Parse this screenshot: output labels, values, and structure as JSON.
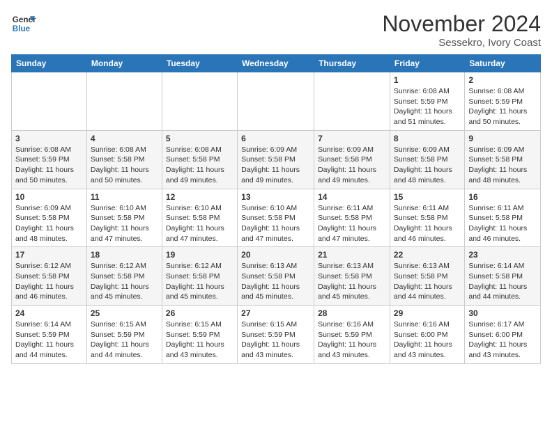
{
  "header": {
    "logo_line1": "General",
    "logo_line2": "Blue",
    "month_title": "November 2024",
    "subtitle": "Sessekro, Ivory Coast"
  },
  "days_of_week": [
    "Sunday",
    "Monday",
    "Tuesday",
    "Wednesday",
    "Thursday",
    "Friday",
    "Saturday"
  ],
  "weeks": [
    [
      {
        "day": "",
        "info": ""
      },
      {
        "day": "",
        "info": ""
      },
      {
        "day": "",
        "info": ""
      },
      {
        "day": "",
        "info": ""
      },
      {
        "day": "",
        "info": ""
      },
      {
        "day": "1",
        "info": "Sunrise: 6:08 AM\nSunset: 5:59 PM\nDaylight: 11 hours and 51 minutes."
      },
      {
        "day": "2",
        "info": "Sunrise: 6:08 AM\nSunset: 5:59 PM\nDaylight: 11 hours and 50 minutes."
      }
    ],
    [
      {
        "day": "3",
        "info": "Sunrise: 6:08 AM\nSunset: 5:59 PM\nDaylight: 11 hours and 50 minutes."
      },
      {
        "day": "4",
        "info": "Sunrise: 6:08 AM\nSunset: 5:58 PM\nDaylight: 11 hours and 50 minutes."
      },
      {
        "day": "5",
        "info": "Sunrise: 6:08 AM\nSunset: 5:58 PM\nDaylight: 11 hours and 49 minutes."
      },
      {
        "day": "6",
        "info": "Sunrise: 6:09 AM\nSunset: 5:58 PM\nDaylight: 11 hours and 49 minutes."
      },
      {
        "day": "7",
        "info": "Sunrise: 6:09 AM\nSunset: 5:58 PM\nDaylight: 11 hours and 49 minutes."
      },
      {
        "day": "8",
        "info": "Sunrise: 6:09 AM\nSunset: 5:58 PM\nDaylight: 11 hours and 48 minutes."
      },
      {
        "day": "9",
        "info": "Sunrise: 6:09 AM\nSunset: 5:58 PM\nDaylight: 11 hours and 48 minutes."
      }
    ],
    [
      {
        "day": "10",
        "info": "Sunrise: 6:09 AM\nSunset: 5:58 PM\nDaylight: 11 hours and 48 minutes."
      },
      {
        "day": "11",
        "info": "Sunrise: 6:10 AM\nSunset: 5:58 PM\nDaylight: 11 hours and 47 minutes."
      },
      {
        "day": "12",
        "info": "Sunrise: 6:10 AM\nSunset: 5:58 PM\nDaylight: 11 hours and 47 minutes."
      },
      {
        "day": "13",
        "info": "Sunrise: 6:10 AM\nSunset: 5:58 PM\nDaylight: 11 hours and 47 minutes."
      },
      {
        "day": "14",
        "info": "Sunrise: 6:11 AM\nSunset: 5:58 PM\nDaylight: 11 hours and 47 minutes."
      },
      {
        "day": "15",
        "info": "Sunrise: 6:11 AM\nSunset: 5:58 PM\nDaylight: 11 hours and 46 minutes."
      },
      {
        "day": "16",
        "info": "Sunrise: 6:11 AM\nSunset: 5:58 PM\nDaylight: 11 hours and 46 minutes."
      }
    ],
    [
      {
        "day": "17",
        "info": "Sunrise: 6:12 AM\nSunset: 5:58 PM\nDaylight: 11 hours and 46 minutes."
      },
      {
        "day": "18",
        "info": "Sunrise: 6:12 AM\nSunset: 5:58 PM\nDaylight: 11 hours and 45 minutes."
      },
      {
        "day": "19",
        "info": "Sunrise: 6:12 AM\nSunset: 5:58 PM\nDaylight: 11 hours and 45 minutes."
      },
      {
        "day": "20",
        "info": "Sunrise: 6:13 AM\nSunset: 5:58 PM\nDaylight: 11 hours and 45 minutes."
      },
      {
        "day": "21",
        "info": "Sunrise: 6:13 AM\nSunset: 5:58 PM\nDaylight: 11 hours and 45 minutes."
      },
      {
        "day": "22",
        "info": "Sunrise: 6:13 AM\nSunset: 5:58 PM\nDaylight: 11 hours and 44 minutes."
      },
      {
        "day": "23",
        "info": "Sunrise: 6:14 AM\nSunset: 5:58 PM\nDaylight: 11 hours and 44 minutes."
      }
    ],
    [
      {
        "day": "24",
        "info": "Sunrise: 6:14 AM\nSunset: 5:59 PM\nDaylight: 11 hours and 44 minutes."
      },
      {
        "day": "25",
        "info": "Sunrise: 6:15 AM\nSunset: 5:59 PM\nDaylight: 11 hours and 44 minutes."
      },
      {
        "day": "26",
        "info": "Sunrise: 6:15 AM\nSunset: 5:59 PM\nDaylight: 11 hours and 43 minutes."
      },
      {
        "day": "27",
        "info": "Sunrise: 6:15 AM\nSunset: 5:59 PM\nDaylight: 11 hours and 43 minutes."
      },
      {
        "day": "28",
        "info": "Sunrise: 6:16 AM\nSunset: 5:59 PM\nDaylight: 11 hours and 43 minutes."
      },
      {
        "day": "29",
        "info": "Sunrise: 6:16 AM\nSunset: 6:00 PM\nDaylight: 11 hours and 43 minutes."
      },
      {
        "day": "30",
        "info": "Sunrise: 6:17 AM\nSunset: 6:00 PM\nDaylight: 11 hours and 43 minutes."
      }
    ]
  ]
}
